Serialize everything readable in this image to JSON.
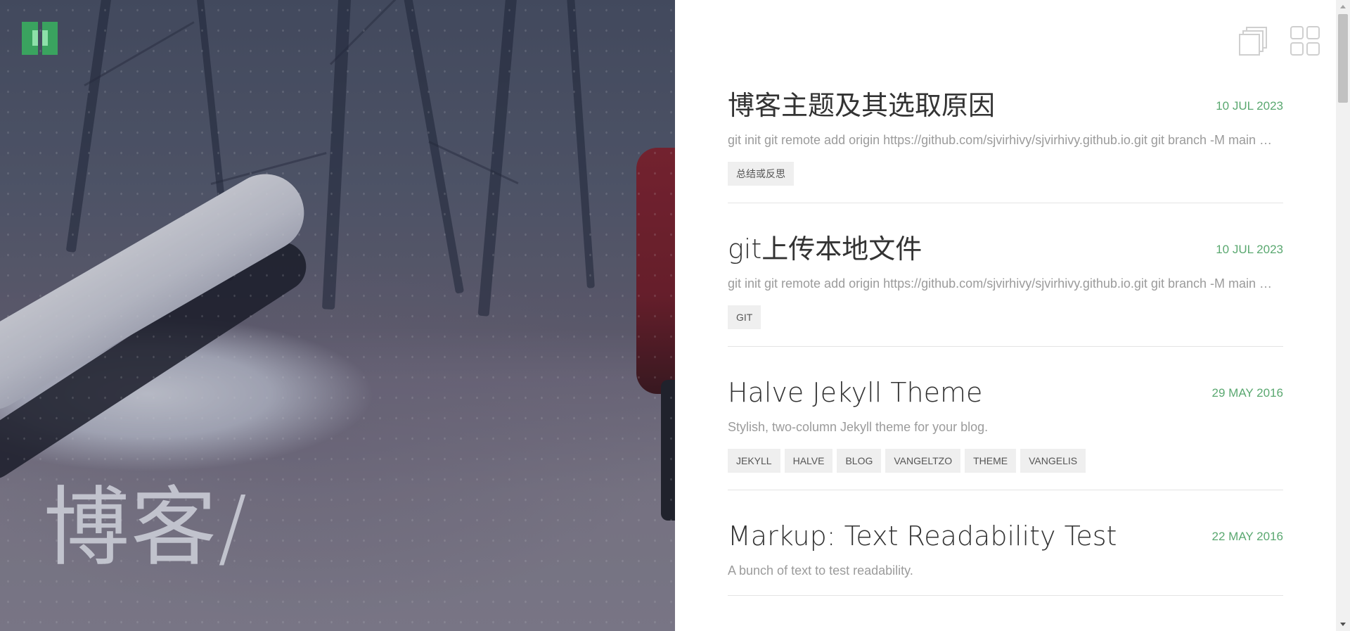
{
  "hero": {
    "title": "博客/"
  },
  "colors": {
    "accent": "#5aa870",
    "logo": "#3aa35f",
    "title": "#333333",
    "excerpt": "#9b9b9b",
    "tag_bg": "#efefef"
  },
  "view_toggle": {
    "list_icon": "stacked-cards-icon",
    "grid_icon": "grid-icon"
  },
  "posts": [
    {
      "title": "博客主题及其选取原因",
      "date": "10 JUL 2023",
      "excerpt": "git init git remote add origin https://github.com/sjvirhivy/sjvirhivy.github.io.git git branch -M main git push -u origin main",
      "tags": [
        "总结或反思"
      ]
    },
    {
      "title": "git上传本地文件",
      "date": "10 JUL 2023",
      "excerpt": "git init git remote add origin https://github.com/sjvirhivy/sjvirhivy.github.io.git git branch -M main git push -u origin main",
      "tags": [
        "GIT"
      ]
    },
    {
      "title": "Halve Jekyll Theme",
      "date": "29 MAY 2016",
      "excerpt": "Stylish, two-column Jekyll theme for your blog.",
      "tags": [
        "JEKYLL",
        "HALVE",
        "BLOG",
        "VANGELTZO",
        "THEME",
        "VANGELIS"
      ]
    },
    {
      "title": "Markup: Text Readability Test",
      "date": "22 MAY 2016",
      "excerpt": "A bunch of text to test readability.",
      "tags": []
    }
  ]
}
